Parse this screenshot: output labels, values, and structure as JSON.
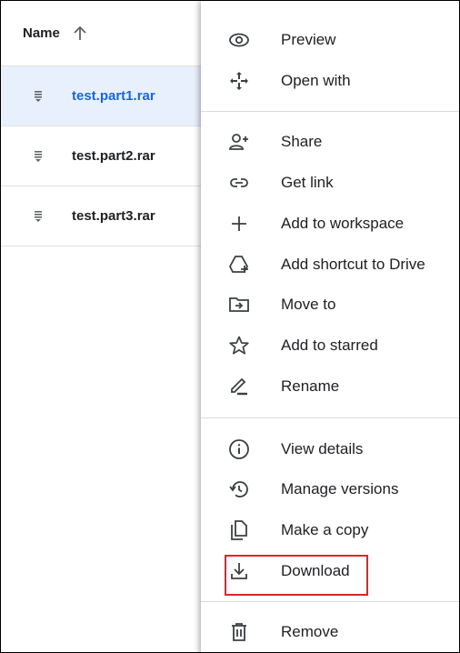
{
  "list": {
    "header": {
      "label": "Name"
    },
    "files": [
      {
        "name": "test.part1.rar"
      },
      {
        "name": "test.part2.rar"
      },
      {
        "name": "test.part3.rar"
      }
    ]
  },
  "menu": {
    "items": [
      {
        "label": "Preview",
        "icon": "eye-icon"
      },
      {
        "label": "Open with",
        "icon": "move-arrows-icon"
      },
      {
        "label": "Share",
        "icon": "person-add-icon"
      },
      {
        "label": "Get link",
        "icon": "link-icon"
      },
      {
        "label": "Add to workspace",
        "icon": "plus-icon"
      },
      {
        "label": "Add shortcut to Drive",
        "icon": "drive-shortcut-icon"
      },
      {
        "label": "Move to",
        "icon": "folder-move-icon"
      },
      {
        "label": "Add to starred",
        "icon": "star-icon"
      },
      {
        "label": "Rename",
        "icon": "pencil-icon"
      },
      {
        "label": "View details",
        "icon": "info-icon"
      },
      {
        "label": "Manage versions",
        "icon": "history-icon"
      },
      {
        "label": "Make a copy",
        "icon": "copy-icon"
      },
      {
        "label": "Download",
        "icon": "download-icon"
      },
      {
        "label": "Remove",
        "icon": "trash-icon"
      }
    ]
  },
  "colors": {
    "selected_row_bg": "#e8f0fe",
    "selected_text": "#1967d2",
    "highlight_border": "#e0242b"
  }
}
